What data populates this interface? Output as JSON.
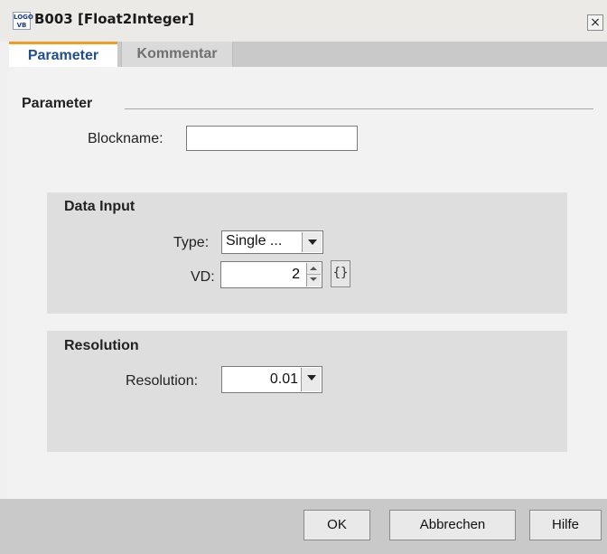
{
  "window": {
    "title": "B003 [Float2Integer]",
    "icon_text": "LOGO\nVB",
    "close_label": "×"
  },
  "tabs": [
    {
      "label": "Parameter",
      "active": true
    },
    {
      "label": "Kommentar",
      "active": false
    }
  ],
  "parameter": {
    "section_title": "Parameter",
    "blockname_label": "Blockname:",
    "blockname_value": ""
  },
  "data_input": {
    "title": "Data Input",
    "type_label": "Type:",
    "type_value": "Single ...",
    "vd_label": "VD:",
    "vd_value": "2",
    "bracket_icon": "{}"
  },
  "resolution": {
    "title": "Resolution",
    "label": "Resolution:",
    "value": "0.01"
  },
  "buttons": {
    "ok": "OK",
    "cancel": "Abbrechen",
    "help": "Hilfe"
  },
  "colors": {
    "active_tab_accent": "#f39c20",
    "active_tab_text": "#1f4f8f"
  }
}
